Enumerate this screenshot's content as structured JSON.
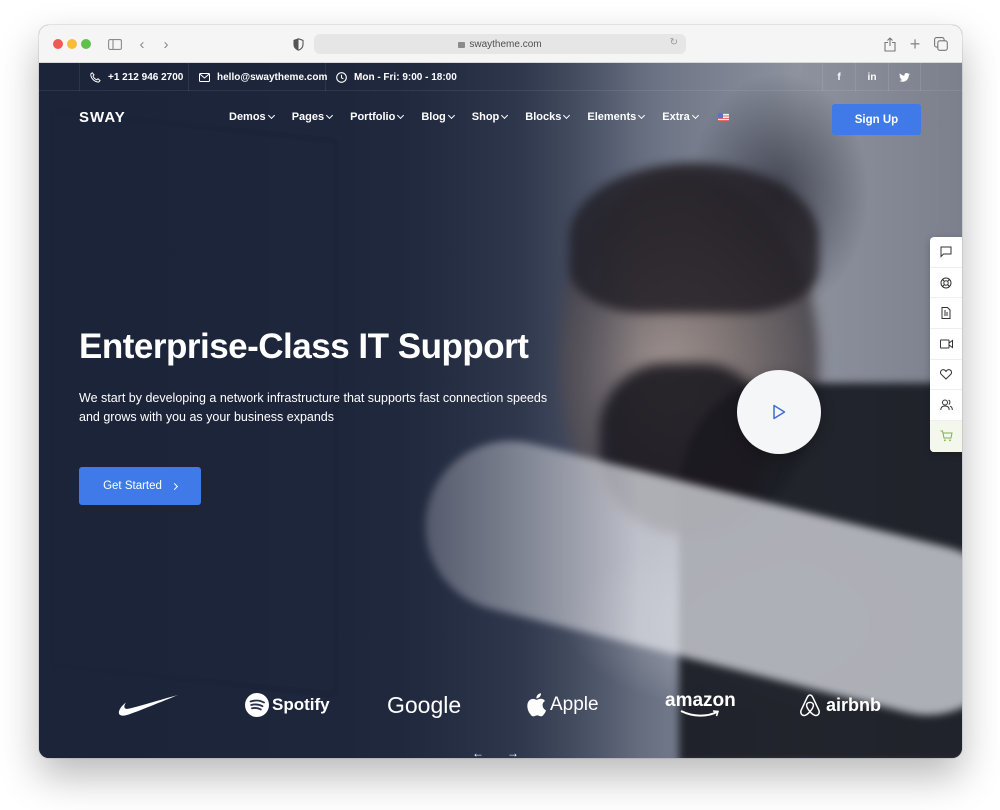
{
  "browser": {
    "url": "swaytheme.com"
  },
  "topbar": {
    "phone": "+1 212 946 2700",
    "email": "hello@swaytheme.com",
    "hours": "Mon - Fri: 9:00 - 18:00",
    "social": [
      {
        "name": "facebook",
        "label": "f"
      },
      {
        "name": "linkedin",
        "label": "in"
      },
      {
        "name": "twitter",
        "label": "twitter"
      }
    ]
  },
  "header": {
    "logo": "SWAY",
    "nav": [
      {
        "label": "Demos"
      },
      {
        "label": "Pages"
      },
      {
        "label": "Portfolio"
      },
      {
        "label": "Blog"
      },
      {
        "label": "Shop"
      },
      {
        "label": "Blocks"
      },
      {
        "label": "Elements"
      },
      {
        "label": "Extra"
      }
    ],
    "language_flag": "us-flag-icon",
    "signup_label": "Sign Up"
  },
  "hero": {
    "title": "Enterprise-Class IT Support",
    "subtitle": "We start by developing a network infrastructure that supports fast connection speeds and grows with you as your business expands",
    "cta_label": "Get Started",
    "play_icon": "play-icon"
  },
  "dock": {
    "items": [
      "chat-icon",
      "support-icon",
      "document-icon",
      "video-icon",
      "heart-icon",
      "users-icon",
      "cart-icon"
    ]
  },
  "clients": {
    "logos": [
      {
        "name": "Nike",
        "text": ""
      },
      {
        "name": "Spotify",
        "text": "Spotify"
      },
      {
        "name": "Google",
        "text": "Google"
      },
      {
        "name": "Apple",
        "text": "Apple"
      },
      {
        "name": "Amazon",
        "text": "amazon"
      },
      {
        "name": "Airbnb",
        "text": "airbnb"
      }
    ]
  },
  "slider": {
    "prev_label": "←",
    "next_label": "→"
  },
  "colors": {
    "accent": "#3f7ae8",
    "hero_overlay": "#1c2438",
    "cart_accent": "#7cb342"
  }
}
